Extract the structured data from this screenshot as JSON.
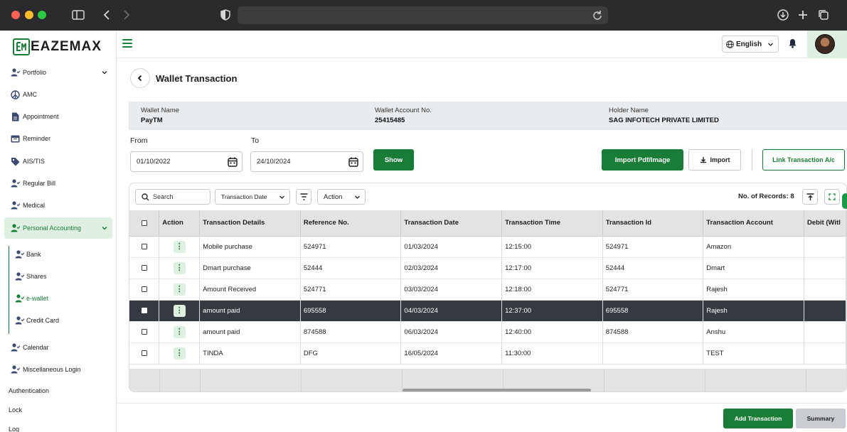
{
  "browser": {
    "url": ""
  },
  "brand": {
    "name": "EAZEMAX",
    "accent": "#1a7d37"
  },
  "sidebar": {
    "items": [
      {
        "label": "Portfolio",
        "icon": "user-check-icon"
      },
      {
        "label": "AMC",
        "icon": "peace-icon"
      },
      {
        "label": "Appointment",
        "icon": "document-icon"
      },
      {
        "label": "Reminder",
        "icon": "calendar-icon"
      },
      {
        "label": "AIS/TIS",
        "icon": "tag-icon"
      },
      {
        "label": "Regular Bill",
        "icon": "user-check-icon"
      },
      {
        "label": "Medical",
        "icon": "user-check-icon"
      },
      {
        "label": "Personal Accounting",
        "icon": "user-check-icon"
      }
    ],
    "sub_items": [
      {
        "label": "Bank",
        "icon": "user-check-icon"
      },
      {
        "label": "Shares",
        "icon": "user-check-icon"
      },
      {
        "label": "e-wallet",
        "icon": "user-check-icon"
      },
      {
        "label": "Credit Card",
        "icon": "user-check-icon"
      }
    ],
    "more_items": [
      {
        "label": "Calendar",
        "icon": "user-check-icon"
      },
      {
        "label": "Miscellaneous Login",
        "icon": "user-check-icon"
      }
    ],
    "plain_items": [
      "Authentication",
      "Lock",
      "Log"
    ]
  },
  "topbar": {
    "language": "English"
  },
  "page": {
    "title": "Wallet Transaction"
  },
  "info": {
    "wallet_name_label": "Wallet Name",
    "wallet_name": "PayTM",
    "account_label": "Wallet Account No.",
    "account": "25415485",
    "holder_label": "Holder Name",
    "holder": "SAG INFOTECH PRIVATE LIMITED"
  },
  "filters": {
    "from_label": "From",
    "from_value": "01/10/2022",
    "to_label": "To",
    "to_value": "24/10/2024",
    "show_label": "Show"
  },
  "actions": {
    "import_pdf": "Import Pdf/Image",
    "import": "Import",
    "link": "Link Transaction A/c"
  },
  "grid_toolbar": {
    "search": "Search",
    "column_select": "Transaction Date",
    "action_select": "Action",
    "records": "No. of Records: 8"
  },
  "table": {
    "columns": [
      "Action",
      "Transaction Details",
      "Reference No.",
      "Transaction Date",
      "Transaction Time",
      "Transaction Id",
      "Transaction Account",
      "Debit (Witl"
    ],
    "rows": [
      {
        "details": "Mobile purchase",
        "ref": "524971",
        "date": "01/03/2024",
        "time": "12:15:00",
        "id": "524971",
        "account": "Amazon",
        "debit": ""
      },
      {
        "details": "Dmart purchase",
        "ref": "52444",
        "date": "02/03/2024",
        "time": "12:17:00",
        "id": "52444",
        "account": "Dmart",
        "debit": ""
      },
      {
        "details": "Amount Received",
        "ref": "524771",
        "date": "03/03/2024",
        "time": "12:18:00",
        "id": "524771",
        "account": "Rajesh",
        "debit": ""
      },
      {
        "details": "amount paid",
        "ref": "695558",
        "date": "04/03/2024",
        "time": "12:37:00",
        "id": "695558",
        "account": "Rajesh",
        "debit": ""
      },
      {
        "details": "amount paid",
        "ref": "874588",
        "date": "06/03/2024",
        "time": "12:40:00",
        "id": "874588",
        "account": "Anshu",
        "debit": ""
      },
      {
        "details": "TINDA",
        "ref": "DFG",
        "date": "16/05/2024",
        "time": "11:30:00",
        "id": "",
        "account": "TEST",
        "debit": ""
      }
    ],
    "selected_row": 3
  },
  "footer": {
    "add": "Add Transaction",
    "summary": "Summary"
  }
}
